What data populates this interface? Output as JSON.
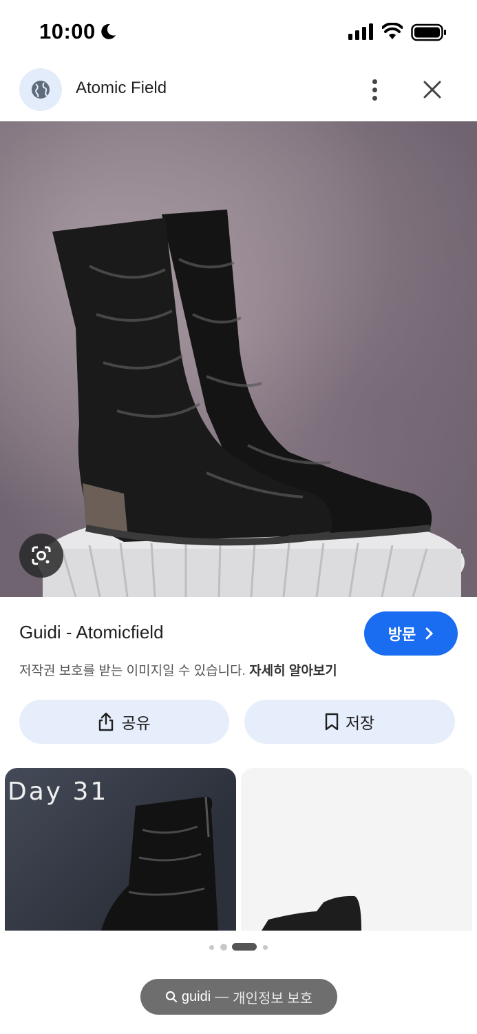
{
  "status_bar": {
    "time": "10:00"
  },
  "header": {
    "site_name": "Atomic Field"
  },
  "result": {
    "title": "Guidi - Atomicfield",
    "visit_label": "방문",
    "copyright_text": "저작권 보호를 받는 이미지일 수 있습니다.",
    "learn_more_label": "자세히 알아보기",
    "share_label": "공유",
    "save_label": "저장"
  },
  "related": [
    {
      "caption": "Day 31"
    },
    {
      "caption": ""
    }
  ],
  "pagination": {
    "total": 4,
    "active_index": 2
  },
  "search_chip": {
    "query": "guidi",
    "separator": "—",
    "privacy_label": "개인정보 보호"
  },
  "colors": {
    "accent": "#1a6cf0",
    "pill_bg": "#e6eefb",
    "chip_bg": "#6e6e6e"
  }
}
